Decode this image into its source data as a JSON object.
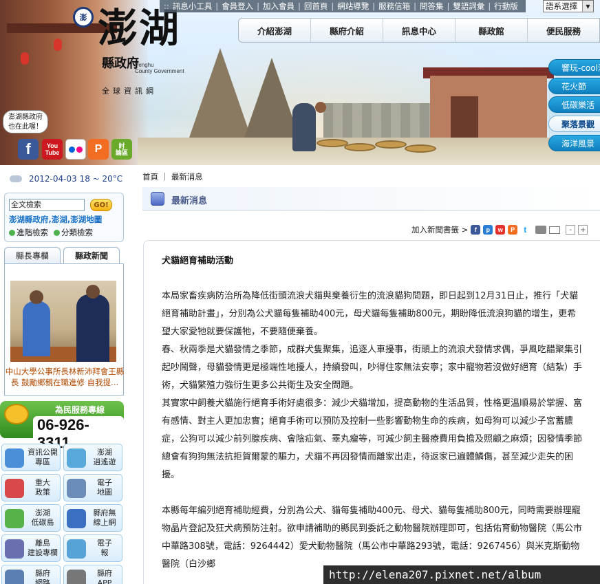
{
  "top_links": [
    "訊息小工具",
    "會員登入",
    "加入會員",
    "回首頁",
    "網站導覽",
    "服務信箱",
    "問答集",
    "雙語詞彙",
    "行動版"
  ],
  "lang_select": "語系選擇",
  "logo": {
    "seal": "澎",
    "title": "澎湖",
    "subtitle": "縣政府",
    "english_line1": "Penghu",
    "english_line2": "County Government",
    "tagline": "全球資訊網"
  },
  "main_nav": [
    "介紹澎湖",
    "縣府介紹",
    "訊息中心",
    "縣政館",
    "便民服務"
  ],
  "side_pills": [
    {
      "label": "響玩-cool澎湖",
      "active": false
    },
    {
      "label": "花火節",
      "active": false
    },
    {
      "label": "低碳樂活",
      "active": false
    },
    {
      "label": "聚落景觀",
      "active": true
    },
    {
      "label": "海洋風景",
      "active": false
    }
  ],
  "bubble": {
    "line1": "澎湖縣政府",
    "line2": "也在此喔！"
  },
  "social": {
    "youtube_1": "You",
    "youtube_2": "Tube",
    "plurk": "P",
    "facebook": "f",
    "forum_1": "討",
    "forum_2": "論區"
  },
  "weather": "2012-04-03 18 ~ 20°C",
  "search": {
    "input_value": "全文檢索",
    "go_label": "GO!",
    "links": "澎湖縣政府,澎湖,澎湖地圖",
    "opt_advanced": "進階檢索",
    "opt_category": "分類檢索"
  },
  "news_tabs": [
    {
      "label": "縣長專欄",
      "active": false
    },
    {
      "label": "縣政新聞",
      "active": true
    }
  ],
  "news_caption": "中山大學公事所長林新沛拜會王縣長 鼓勵鄉親在職進修 自我提...",
  "hotline": {
    "label": "為民服務專線",
    "number": "06-926-3311"
  },
  "services": [
    {
      "l1": "資訊公開",
      "l2": "專區",
      "color": "#4a8fd8"
    },
    {
      "l1": "澎湖",
      "l2": "逍遙遊",
      "color": "#58a9d9"
    },
    {
      "l1": "重大",
      "l2": "政策",
      "color": "#d84a4a"
    },
    {
      "l1": "電子",
      "l2": "地圖",
      "color": "#6c8db8"
    },
    {
      "l1": "澎湖",
      "l2": "低碳島",
      "color": "#58b24a"
    },
    {
      "l1": "縣府無",
      "l2": "線上網",
      "color": "#3a6fc2"
    },
    {
      "l1": "離島",
      "l2": "建設專欄",
      "color": "#6a6fb0"
    },
    {
      "l1": "電子",
      "l2": "報",
      "color": "#57a3d8"
    },
    {
      "l1": "縣府",
      "l2": "網路",
      "color": "#5a7fb0"
    },
    {
      "l1": "縣府",
      "l2": "APP",
      "color": "#777"
    }
  ],
  "breadcrumb": {
    "home": "首頁",
    "sep": "｜",
    "current": "最新消息"
  },
  "section_title": "最新消息",
  "tools": {
    "bookmark_label": "加入新聞書籤 >",
    "zoom_out": "-",
    "zoom_in": "+"
  },
  "article": {
    "title": "犬貓絕育補助活動",
    "paragraphs": [
      "本局家畜疾病防治所為降低街頭流浪犬貓與棄養衍生的流浪貓狗問題，即日起到12月31日止，推行「犬貓絕育補助計畫」，分別為公犬貓每隻補助400元，母犬貓每隻補助800元，期盼降低流浪狗貓的增生，更希望大家愛牠就要保護牠，不要隨便棄養。",
      "春、秋兩季是犬貓發情之季節，成群犬隻聚集，追逐人車擾事，街頭上的流浪犬發情求偶，爭風吃醋聚集引起吵鬧聲，母貓發情更是極端性地擾人，持續發叫，吵得住家無法安寧；家中寵物若沒做好絕育（結紮）手術，犬貓繁殖力強衍生更多公共衛生及安全問題。",
      "其實家中飼養犬貓施行絕育手術好處很多：減少犬貓增加，提高動物的生活品質，性格更溫順易於掌握、富有感情、對主人更加忠實；絕育手術可以預防及控制一些影響動物生命的疾病，如母狗可以減少子宮蓄膿症，公狗可以減少前列腺疾病、會陰疝氣、睪丸瘤等，可減少飼主醫療費用負擔及照顧之麻煩；因發情季節總會有狗狗無法抗拒賀爾蒙的驅力，犬貓不再因發情而離家出走，待返家已遍體鱗傷，甚至減少走失的困擾。",
      "本縣每年編列絕育補助經費，分別為公犬、貓每隻補助400元、母犬、貓每隻補助800元，同時需要辦理寵物晶片登記及狂犬病預防注射。欲申請補助的縣民到委託之動物醫院辦理即可，包括佑育動物醫院（馬公市中華路308號，電話：9264442）愛犬動物醫院（馬公市中華路293號，電話：9267456）與米克斯動物醫院（白沙鄉"
    ]
  },
  "watermark": "http://elena207.pixnet.net/album"
}
